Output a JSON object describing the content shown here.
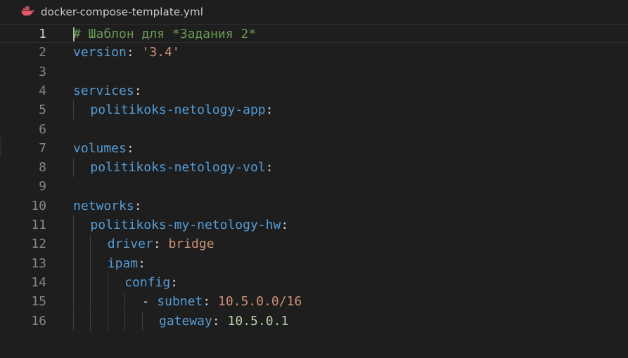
{
  "tab": {
    "icon": "docker-icon",
    "filename": "docker-compose-template.yml",
    "accent": "#e8576e"
  },
  "editor": {
    "current_line": "1",
    "lines": [
      {
        "n": "1",
        "indent": 0,
        "tokens": [
          {
            "t": "# Шаблон для *Задания 2*",
            "c": "comment"
          }
        ]
      },
      {
        "n": "2",
        "indent": 0,
        "tokens": [
          {
            "t": "version",
            "c": "key"
          },
          {
            "t": ": ",
            "c": "punct"
          },
          {
            "t": "'3.4'",
            "c": "str"
          }
        ]
      },
      {
        "n": "3",
        "indent": 0,
        "tokens": []
      },
      {
        "n": "4",
        "indent": 0,
        "tokens": [
          {
            "t": "services",
            "c": "key"
          },
          {
            "t": ":",
            "c": "punct"
          }
        ]
      },
      {
        "n": "5",
        "indent": 1,
        "tokens": [
          {
            "t": "politikoks-netology-app",
            "c": "key"
          },
          {
            "t": ":",
            "c": "punct"
          }
        ]
      },
      {
        "n": "6",
        "indent": 0,
        "tokens": []
      },
      {
        "n": "7",
        "indent": 0,
        "tokens": [
          {
            "t": "volumes",
            "c": "key"
          },
          {
            "t": ":",
            "c": "punct"
          }
        ]
      },
      {
        "n": "8",
        "indent": 1,
        "tokens": [
          {
            "t": "politikoks-netology-vol",
            "c": "key"
          },
          {
            "t": ":",
            "c": "punct"
          }
        ]
      },
      {
        "n": "9",
        "indent": 0,
        "tokens": []
      },
      {
        "n": "10",
        "indent": 0,
        "tokens": [
          {
            "t": "networks",
            "c": "key"
          },
          {
            "t": ":",
            "c": "punct"
          }
        ]
      },
      {
        "n": "11",
        "indent": 1,
        "tokens": [
          {
            "t": "politikoks-my-netology-hw",
            "c": "key"
          },
          {
            "t": ":",
            "c": "punct"
          }
        ]
      },
      {
        "n": "12",
        "indent": 2,
        "tokens": [
          {
            "t": "driver",
            "c": "key"
          },
          {
            "t": ": ",
            "c": "punct"
          },
          {
            "t": "bridge",
            "c": "str"
          }
        ]
      },
      {
        "n": "13",
        "indent": 2,
        "tokens": [
          {
            "t": "ipam",
            "c": "key"
          },
          {
            "t": ":",
            "c": "punct"
          }
        ]
      },
      {
        "n": "14",
        "indent": 3,
        "tokens": [
          {
            "t": "config",
            "c": "key"
          },
          {
            "t": ":",
            "c": "punct"
          }
        ]
      },
      {
        "n": "15",
        "indent": 4,
        "tokens": [
          {
            "t": "- ",
            "c": "punct"
          },
          {
            "t": "subnet",
            "c": "key"
          },
          {
            "t": ": ",
            "c": "punct"
          },
          {
            "t": "10.5.0.0/16",
            "c": "str"
          }
        ]
      },
      {
        "n": "16",
        "indent": 5,
        "tokens": [
          {
            "t": "gateway",
            "c": "key"
          },
          {
            "t": ": ",
            "c": "punct"
          },
          {
            "t": "10.5.0.1",
            "c": "num"
          }
        ]
      }
    ]
  }
}
